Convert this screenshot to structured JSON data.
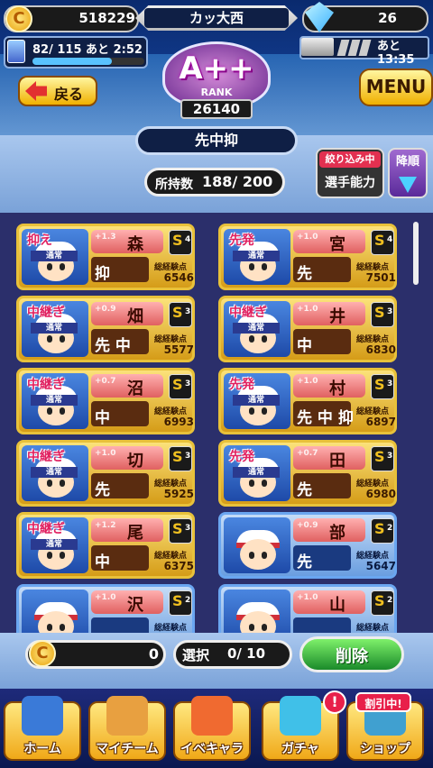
{
  "header": {
    "coins": "518229",
    "player_name": "カッ大西",
    "gems": "26",
    "stamina": "82/ 115",
    "stamina_suffix": "あと 2:52",
    "stamina_fraction": 0.713,
    "ticket_time": "あと13:35",
    "rank": "A++",
    "rank_label": "RANK",
    "rank_score": "26140",
    "back_label": "戻る",
    "menu_label": "MENU"
  },
  "title": "先中抑",
  "filter": {
    "owned_label": "所持数",
    "owned_value": "188/ 200",
    "filtering_label": "絞り込み中",
    "filter_value": "選手能力",
    "sort_label": "降順"
  },
  "cards": [
    {
      "role": "抑え",
      "type": "通常",
      "bonus": "+1.3",
      "name": "森",
      "positions": "抑",
      "rank": "S",
      "rank_num": "4",
      "exp_label": "総経験点",
      "exp": "6546",
      "color": "gold"
    },
    {
      "role": "先発",
      "type": "通常",
      "bonus": "+1.0",
      "name": "宮",
      "positions": "先",
      "rank": "S",
      "rank_num": "4",
      "exp_label": "総経験点",
      "exp": "7501",
      "color": "gold"
    },
    {
      "role": "中継ぎ",
      "type": "通常",
      "bonus": "+0.9",
      "name": "畑",
      "positions": "先 中",
      "rank": "S",
      "rank_num": "3",
      "exp_label": "総経験点",
      "exp": "5577",
      "color": "gold"
    },
    {
      "role": "中継ぎ",
      "type": "通常",
      "bonus": "+1.0",
      "name": "井",
      "positions": "中",
      "rank": "S",
      "rank_num": "3",
      "exp_label": "総経験点",
      "exp": "6830",
      "color": "gold"
    },
    {
      "role": "中継ぎ",
      "type": "通常",
      "bonus": "+0.7",
      "name": "沼",
      "positions": "中",
      "rank": "S",
      "rank_num": "3",
      "exp_label": "総経験点",
      "exp": "6993",
      "color": "gold"
    },
    {
      "role": "先発",
      "type": "通常",
      "bonus": "+1.0",
      "name": "村",
      "positions": "先 中 抑",
      "rank": "S",
      "rank_num": "3",
      "exp_label": "総経験点",
      "exp": "6897",
      "color": "gold"
    },
    {
      "role": "中継ぎ",
      "type": "通常",
      "bonus": "+1.0",
      "name": "切",
      "positions": "先",
      "rank": "S",
      "rank_num": "3",
      "exp_label": "総経験点",
      "exp": "5925",
      "color": "gold"
    },
    {
      "role": "先発",
      "type": "通常",
      "bonus": "+0.7",
      "name": "田",
      "positions": "先",
      "rank": "S",
      "rank_num": "3",
      "exp_label": "総経験点",
      "exp": "6980",
      "color": "gold"
    },
    {
      "role": "中継ぎ",
      "type": "通常",
      "bonus": "+1.2",
      "name": "尾",
      "positions": "中",
      "rank": "S",
      "rank_num": "3",
      "exp_label": "総経験点",
      "exp": "6375",
      "color": "gold"
    },
    {
      "role": "",
      "type": "",
      "bonus": "+0.9",
      "name": "部",
      "positions": "先",
      "rank": "S",
      "rank_num": "2",
      "exp_label": "総経験点",
      "exp": "5647",
      "color": "blue"
    },
    {
      "role": "",
      "type": "",
      "bonus": "+1.0",
      "name": "沢",
      "positions": "",
      "rank": "S",
      "rank_num": "2",
      "exp_label": "総経験点",
      "exp": "",
      "color": "blue"
    },
    {
      "role": "",
      "type": "",
      "bonus": "+1.0",
      "name": "山",
      "positions": "",
      "rank": "S",
      "rank_num": "2",
      "exp_label": "総経験点",
      "exp": "",
      "color": "blue"
    }
  ],
  "footer": {
    "coins": "0",
    "select_label": "選択",
    "select_value": "0/ 10",
    "delete_label": "削除"
  },
  "nav": [
    {
      "label": "ホーム",
      "icon": "home-book-icon"
    },
    {
      "label": "マイチーム",
      "icon": "team-icon"
    },
    {
      "label": "イベキャラ",
      "icon": "event-character-icon"
    },
    {
      "label": "ガチャ",
      "icon": "gacha-icon"
    },
    {
      "label": "ショップ",
      "icon": "shop-icon"
    }
  ],
  "sale_badge": "割引中!",
  "alert_mark": "!",
  "colors": {
    "gold_card": "#f0c030",
    "blue_card": "#6a9ee0",
    "delete_green": "#2aa83a",
    "background": "#0b2a6b"
  }
}
